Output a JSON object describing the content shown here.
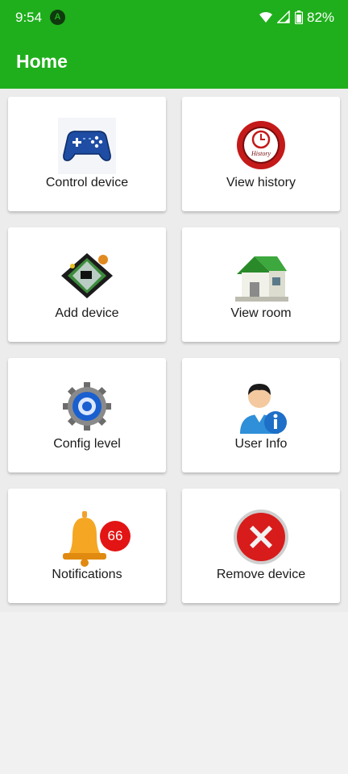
{
  "status_bar": {
    "time": "9:54",
    "battery_percent": "82%"
  },
  "app_bar": {
    "title": "Home"
  },
  "tiles": [
    {
      "label": "Control device",
      "icon": "gamepad-icon"
    },
    {
      "label": "View history",
      "icon": "history-icon"
    },
    {
      "label": "Add device",
      "icon": "circuit-board-icon"
    },
    {
      "label": "View room",
      "icon": "house-icon"
    },
    {
      "label": "Config level",
      "icon": "gear-icon"
    },
    {
      "label": "User Info",
      "icon": "user-info-icon"
    },
    {
      "label": "Notifications",
      "icon": "bell-icon",
      "badge": "66"
    },
    {
      "label": "Remove device",
      "icon": "remove-icon"
    }
  ],
  "history_icon_text": "History",
  "colors": {
    "app_bar": "#1faf1c",
    "background": "#f1f1f1",
    "card": "#ffffff",
    "badge": "#e31414"
  }
}
